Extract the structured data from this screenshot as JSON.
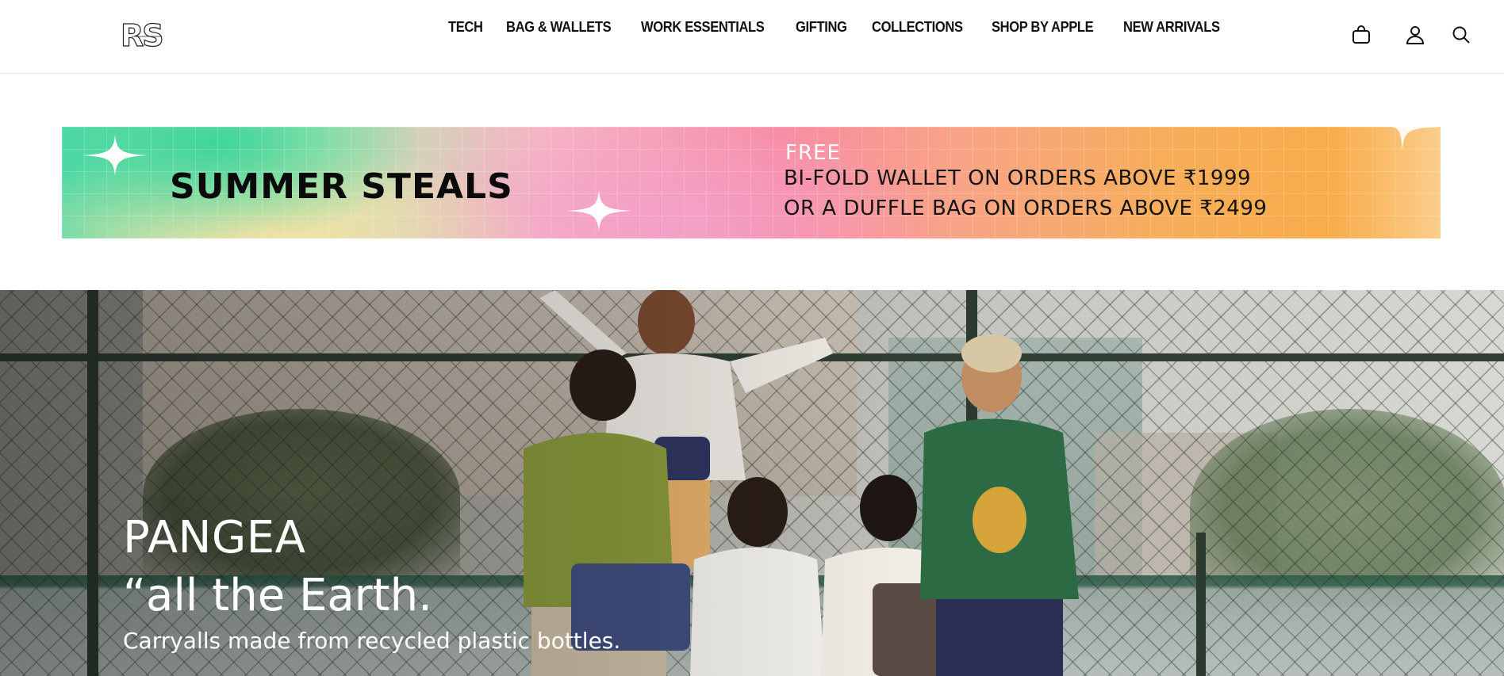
{
  "header": {
    "logo_text": "RS",
    "logo_icon": "rs-logo",
    "nav": [
      {
        "label": "TECH"
      },
      {
        "label": "BAG & WALLETS"
      },
      {
        "label": "WORK ESSENTIALS"
      },
      {
        "label": "GIFTING"
      },
      {
        "label": "COLLECTIONS"
      },
      {
        "label": "SHOP BY APPLE"
      },
      {
        "label": "NEW ARRIVALS"
      }
    ],
    "icons": [
      "bag-icon",
      "user-icon",
      "search-icon"
    ]
  },
  "banner": {
    "title": "SUMMER STEALS",
    "free": "FREE",
    "line1": "BI-FOLD WALLET ON ORDERS ABOVE ₹1999",
    "line2": "OR A DUFFLE BAG ON ORDERS ABOVE ₹2499",
    "icons": [
      "sparkle-icon"
    ]
  },
  "hero": {
    "title": "PANGEA",
    "quote": "“all the Earth.",
    "subtitle": "Carryalls made from recycled plastic bottles."
  },
  "colors": {
    "text": "#111111",
    "hero_text": "#ffffff",
    "banner_green": "#52d9a7",
    "banner_pink": "#f88ba3",
    "banner_orange": "#f8ac4a"
  }
}
